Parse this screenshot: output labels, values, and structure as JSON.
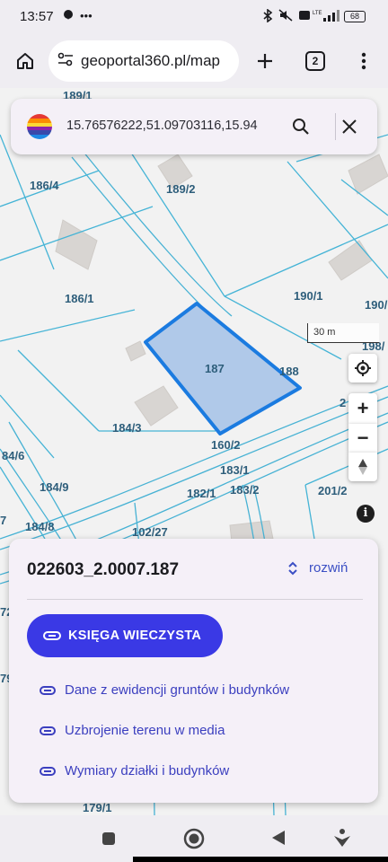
{
  "status_bar": {
    "time": "13:57",
    "extra": "•••",
    "battery": "68"
  },
  "browser": {
    "url": "geoportal360.pl/map",
    "tab_count": "2"
  },
  "search": {
    "coords": "15.76576222,51.09703116,15.94"
  },
  "map": {
    "parcel_labels": [
      "189/1",
      "186/4",
      "189/2",
      "186/1",
      "190/1",
      "190/",
      "198/",
      "187",
      "188",
      "2",
      "184/3",
      "160/2",
      "84/6",
      "183/1",
      "184/9",
      "182/1",
      "183/2",
      "201/2",
      "7",
      "184/8",
      "102/27",
      "72",
      "79/",
      "179/1"
    ],
    "scale": "30 m",
    "colors": {
      "parcel_line": "#45b4d6",
      "selected_fill": "#a4c2e8",
      "selected_stroke": "#1b7be0",
      "label": "#2e5e7b"
    }
  },
  "panel": {
    "parcel_id": "022603_2.0007.187",
    "expand_label": "rozwiń",
    "primary_button": "KSIĘGA WIECZYSTA",
    "links": [
      "Dane z ewidencji gruntów i budynków",
      "Uzbrojenie terenu w media",
      "Wymiary działki i budynków"
    ],
    "accent": "#3a39e5"
  },
  "controls": {
    "zoom_in": "+",
    "zoom_out": "−",
    "info": "i"
  }
}
